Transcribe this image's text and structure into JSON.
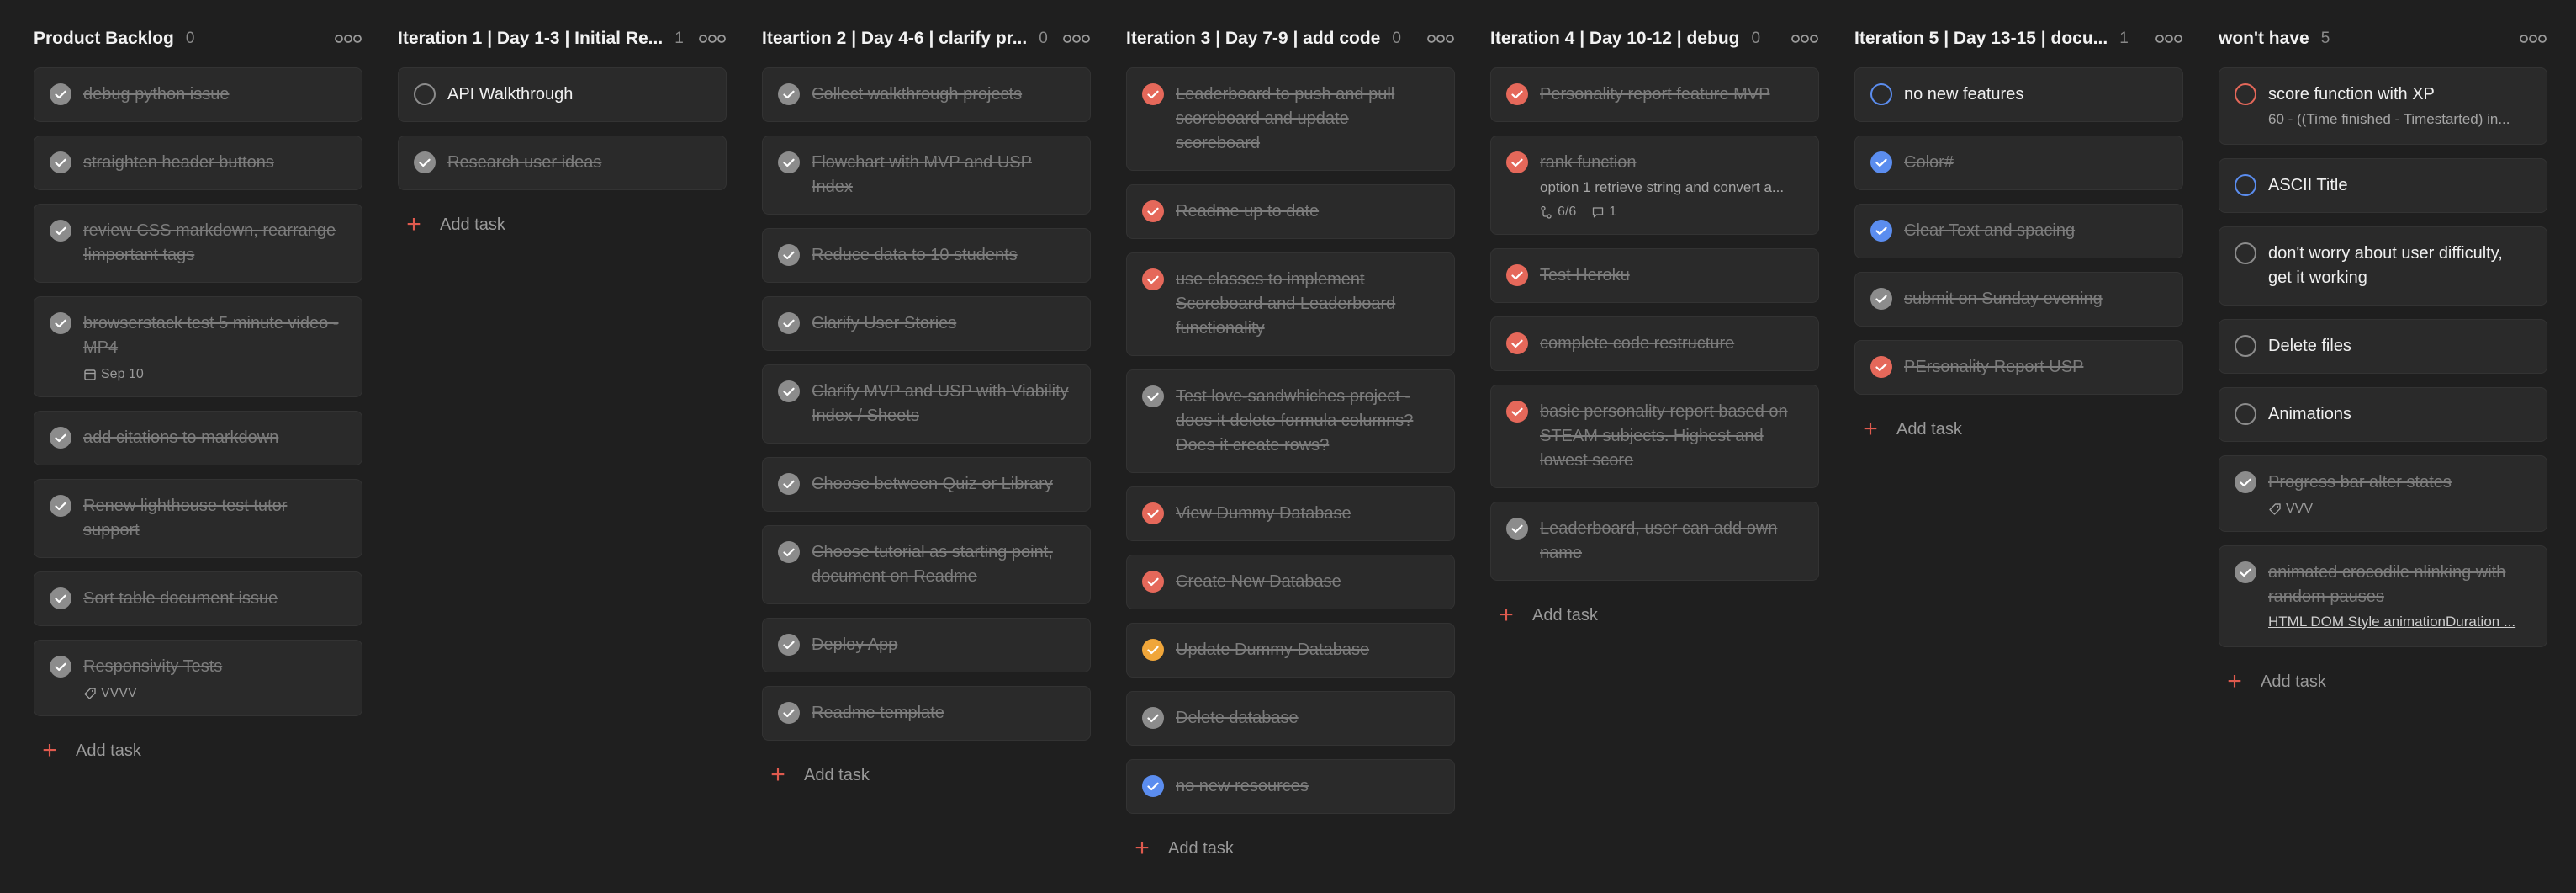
{
  "colors": {
    "red": "#e5685a",
    "grey": "#8c8c8c",
    "blue": "#5b8def",
    "orange": "#f0a63a"
  },
  "add_task_label": "Add task",
  "columns": [
    {
      "title": "Product Backlog",
      "count": "0",
      "tasks": [
        {
          "title": "debug python issue",
          "done": true,
          "color": "grey"
        },
        {
          "title": "straighten header buttons",
          "done": true,
          "color": "grey"
        },
        {
          "title": "review CSS markdown, rearrange !important tags",
          "done": true,
          "color": "grey"
        },
        {
          "title": "browserstack test 5 minute video - MP4",
          "done": true,
          "color": "grey",
          "date": "Sep 10"
        },
        {
          "title": "add citations to markdown",
          "done": true,
          "color": "grey"
        },
        {
          "title": "Renew lighthouse test tutor support",
          "done": true,
          "color": "grey"
        },
        {
          "title": "Sort table document issue",
          "done": true,
          "color": "grey"
        },
        {
          "title": "Responsivity Tests",
          "done": true,
          "color": "grey",
          "tag": "VVVV"
        }
      ]
    },
    {
      "title": "Iteration 1 | Day 1-3 | Initial Re...",
      "count": "1",
      "tasks": [
        {
          "title": "API Walkthrough",
          "done": false,
          "color": "grey"
        },
        {
          "title": "Research user ideas",
          "done": true,
          "color": "grey"
        }
      ]
    },
    {
      "title": "Iteartion 2 | Day 4-6 | clarify pr...",
      "count": "0",
      "tasks": [
        {
          "title": "Collect walkthrough projects",
          "done": true,
          "color": "grey"
        },
        {
          "title": "Flowchart with MVP and USP Index",
          "done": true,
          "color": "grey"
        },
        {
          "title": "Reduce data to 10 students",
          "done": true,
          "color": "grey"
        },
        {
          "title": "Clarify User Stories",
          "done": true,
          "color": "grey"
        },
        {
          "title": "Clarify MVP and USP with Viability Index / Sheets",
          "done": true,
          "color": "grey"
        },
        {
          "title": "Choose between Quiz or Library",
          "done": true,
          "color": "grey"
        },
        {
          "title": "Choose tutorial as starting point, document on Readme",
          "done": true,
          "color": "grey"
        },
        {
          "title": "Deploy App",
          "done": true,
          "color": "grey"
        },
        {
          "title": "Readme template",
          "done": true,
          "color": "grey"
        }
      ]
    },
    {
      "title": "Iteration 3 | Day 7-9 | add code",
      "count": "0",
      "tasks": [
        {
          "title": "Leaderboard to push and pull scoreboard and update scoreboard",
          "done": true,
          "color": "red"
        },
        {
          "title": "Readme up to date",
          "done": true,
          "color": "red"
        },
        {
          "title": "use classes to implement Scoreboard and Leaderboard functionality",
          "done": true,
          "color": "red"
        },
        {
          "title": "Test love-sandwhiches project - does it delete formula columns? Does it create rows?",
          "done": true,
          "color": "grey"
        },
        {
          "title": "View Dummy Database",
          "done": true,
          "color": "red"
        },
        {
          "title": "Create New Database",
          "done": true,
          "color": "red"
        },
        {
          "title": "Update Dummy Database",
          "done": true,
          "color": "orange"
        },
        {
          "title": "Delete database",
          "done": true,
          "color": "grey"
        },
        {
          "title": "no new resources",
          "done": true,
          "color": "blue"
        }
      ]
    },
    {
      "title": "Iteration 4 | Day 10-12 | debug",
      "count": "0",
      "tasks": [
        {
          "title": "Personality report feature MVP",
          "done": true,
          "color": "red"
        },
        {
          "title": "rank function",
          "done": true,
          "color": "red",
          "desc": "option 1 retrieve string and convert a...",
          "subtasks": "6/6",
          "comments": "1"
        },
        {
          "title": "Test Heroku",
          "done": true,
          "color": "red"
        },
        {
          "title": "complete code restructure",
          "done": true,
          "color": "red"
        },
        {
          "title": "basic personality report based on STEAM subjects. Highest and lowest score",
          "done": true,
          "color": "red"
        },
        {
          "title": "Leaderboard, user can add own name",
          "done": true,
          "color": "grey"
        }
      ]
    },
    {
      "title": "Iteration 5 | Day 13-15 | docu...",
      "count": "1",
      "tasks": [
        {
          "title": "no new features",
          "done": false,
          "color": "blue"
        },
        {
          "title": "Color#",
          "done": true,
          "color": "blue"
        },
        {
          "title": "Clear Text and spacing",
          "done": true,
          "color": "blue"
        },
        {
          "title": "submit on Sunday evening",
          "done": true,
          "color": "grey"
        },
        {
          "title": "PErsonality Report USP",
          "done": true,
          "color": "red"
        }
      ]
    },
    {
      "title": "won't have",
      "count": "5",
      "tasks": [
        {
          "title": "score function with XP",
          "done": false,
          "color": "red",
          "desc": "60 - ((Time finished - Timestarted) in..."
        },
        {
          "title": "ASCII Title",
          "done": false,
          "color": "blue"
        },
        {
          "title": "don't worry about user difficulty, get it working",
          "done": false,
          "color": "grey"
        },
        {
          "title": "Delete files",
          "done": false,
          "color": "grey"
        },
        {
          "title": "Animations",
          "done": false,
          "color": "grey"
        },
        {
          "title": "Progress bar alter states",
          "done": true,
          "color": "grey",
          "tag": "VVV"
        },
        {
          "title": "animated crocodile nlinking with random pauses",
          "done": true,
          "color": "grey",
          "desc": "HTML DOM Style animationDuration ...",
          "desc_link": true
        }
      ]
    }
  ]
}
